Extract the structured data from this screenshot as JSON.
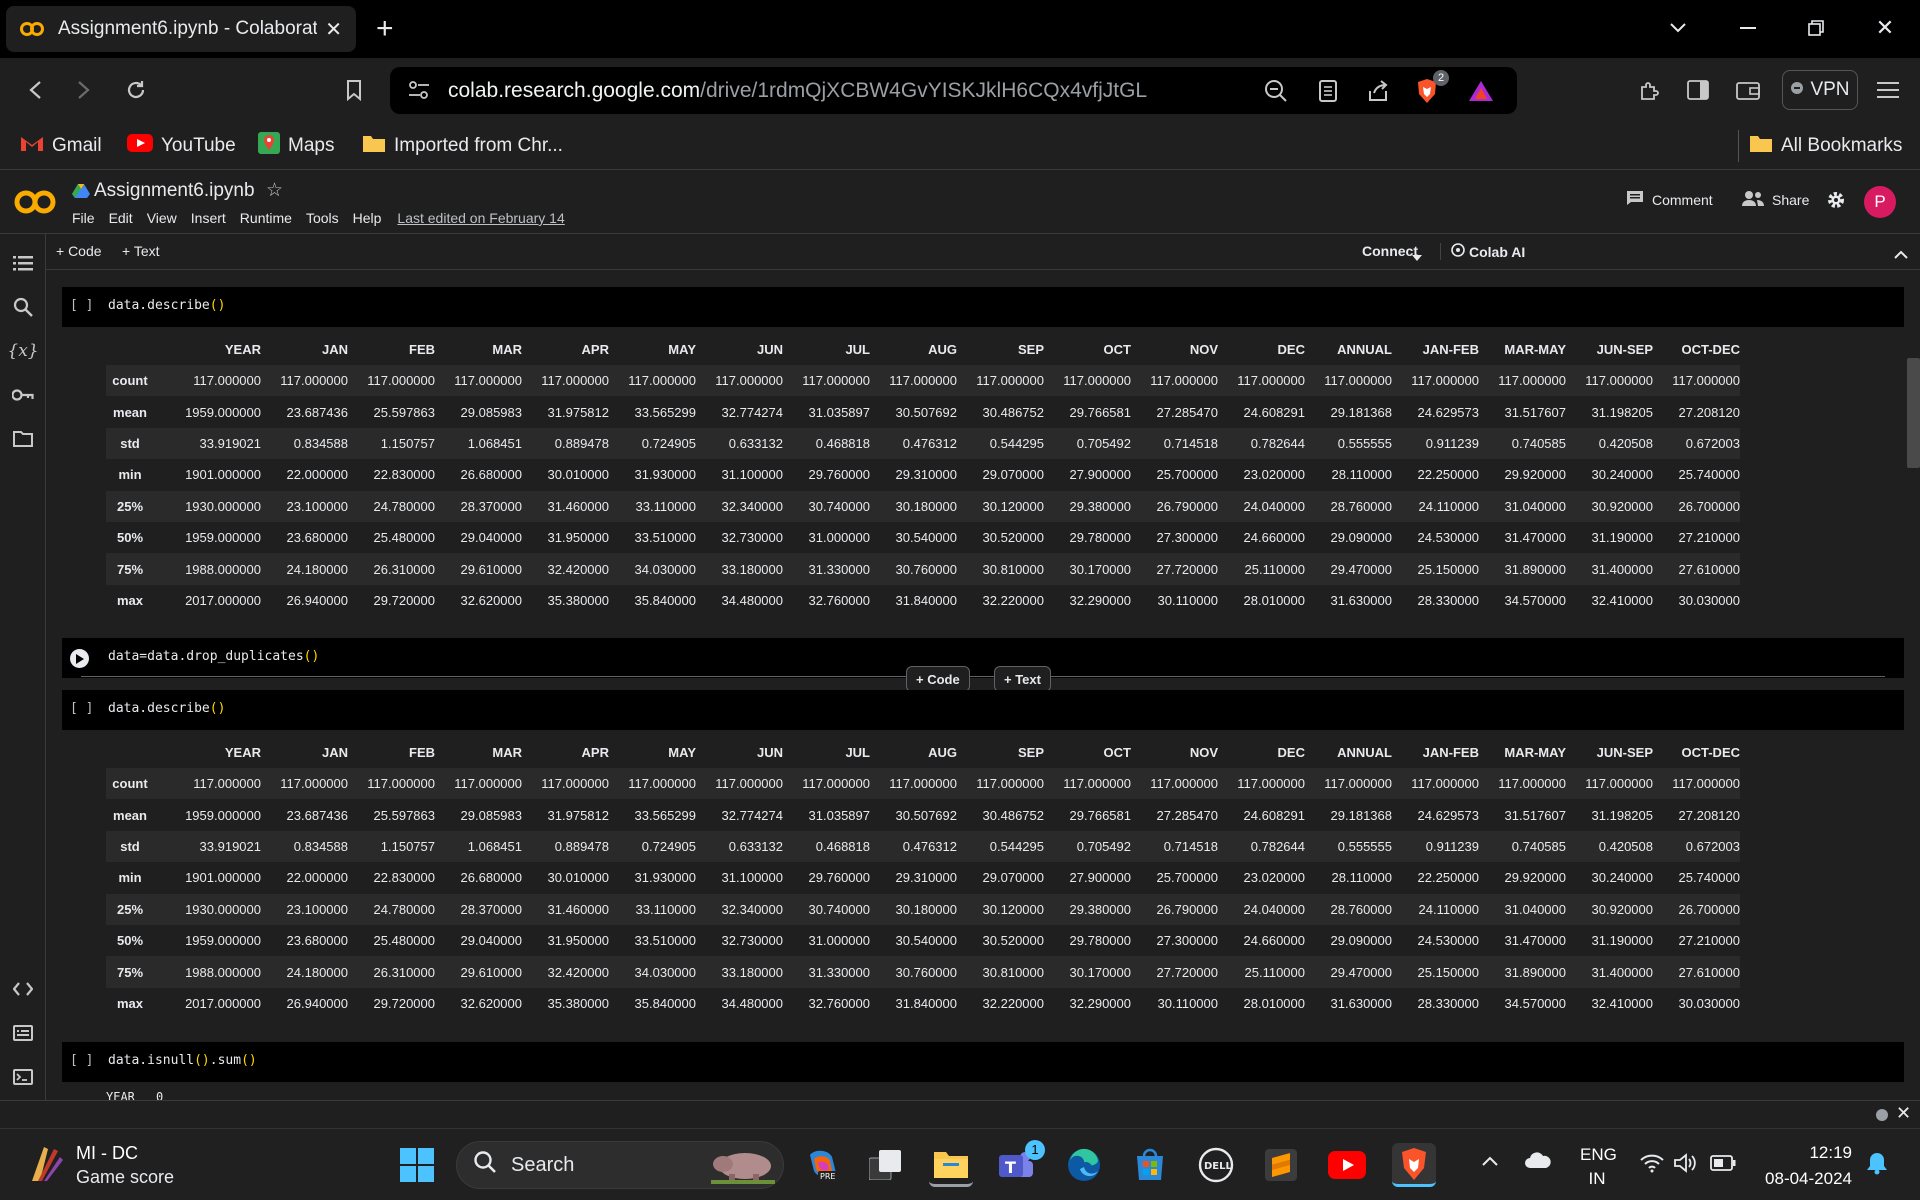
{
  "browser": {
    "tab_title": "Assignment6.ipynb - Colaboratory",
    "url_host": "colab.research.google.com",
    "url_path": "/drive/1rdmQjXCBW4GvYISKJklH6CQx4vfjJtGL",
    "brave_badge": "2",
    "vpn_label": "VPN",
    "bookmarks": [
      "Gmail",
      "YouTube",
      "Maps",
      "Imported from Chr..."
    ],
    "all_bookmarks": "All Bookmarks"
  },
  "colab": {
    "notebook_title": "Assignment6.ipynb",
    "menu": [
      "File",
      "Edit",
      "View",
      "Insert",
      "Runtime",
      "Tools",
      "Help"
    ],
    "last_edited": "Last edited on February 14",
    "comment_label": "Comment",
    "share_label": "Share",
    "avatar_letter": "P",
    "add_code": "+ Code",
    "add_text": "+ Text",
    "connect_label": "Connect",
    "colab_ai_label": "Colab AI"
  },
  "cells": {
    "cell1_bracket": "[ ]",
    "cell1_code": "data.describe",
    "cell2_code": "data=data.drop_duplicates",
    "cell3_bracket": "[ ]",
    "cell3_code": "data.describe",
    "cell4_bracket": "[ ]",
    "cell4_code": "data.isnull",
    "cell4_code_tail": ".sum",
    "cell4_output_label": "YEAR",
    "cell4_output_value": "0",
    "insert_code": "+ Code",
    "insert_text": "+ Text",
    "parens": "()"
  },
  "describe_table": {
    "columns": [
      "YEAR",
      "JAN",
      "FEB",
      "MAR",
      "APR",
      "MAY",
      "JUN",
      "JUL",
      "AUG",
      "SEP",
      "OCT",
      "NOV",
      "DEC",
      "ANNUAL",
      "JAN-FEB",
      "MAR-MAY",
      "JUN-SEP",
      "OCT-DEC"
    ],
    "rows": [
      {
        "label": "count",
        "values": [
          "117.000000",
          "117.000000",
          "117.000000",
          "117.000000",
          "117.000000",
          "117.000000",
          "117.000000",
          "117.000000",
          "117.000000",
          "117.000000",
          "117.000000",
          "117.000000",
          "117.000000",
          "117.000000",
          "117.000000",
          "117.000000",
          "117.000000",
          "117.000000"
        ]
      },
      {
        "label": "mean",
        "values": [
          "1959.000000",
          "23.687436",
          "25.597863",
          "29.085983",
          "31.975812",
          "33.565299",
          "32.774274",
          "31.035897",
          "30.507692",
          "30.486752",
          "29.766581",
          "27.285470",
          "24.608291",
          "29.181368",
          "24.629573",
          "31.517607",
          "31.198205",
          "27.208120"
        ]
      },
      {
        "label": "std",
        "values": [
          "33.919021",
          "0.834588",
          "1.150757",
          "1.068451",
          "0.889478",
          "0.724905",
          "0.633132",
          "0.468818",
          "0.476312",
          "0.544295",
          "0.705492",
          "0.714518",
          "0.782644",
          "0.555555",
          "0.911239",
          "0.740585",
          "0.420508",
          "0.672003"
        ]
      },
      {
        "label": "min",
        "values": [
          "1901.000000",
          "22.000000",
          "22.830000",
          "26.680000",
          "30.010000",
          "31.930000",
          "31.100000",
          "29.760000",
          "29.310000",
          "29.070000",
          "27.900000",
          "25.700000",
          "23.020000",
          "28.110000",
          "22.250000",
          "29.920000",
          "30.240000",
          "25.740000"
        ]
      },
      {
        "label": "25%",
        "values": [
          "1930.000000",
          "23.100000",
          "24.780000",
          "28.370000",
          "31.460000",
          "33.110000",
          "32.340000",
          "30.740000",
          "30.180000",
          "30.120000",
          "29.380000",
          "26.790000",
          "24.040000",
          "28.760000",
          "24.110000",
          "31.040000",
          "30.920000",
          "26.700000"
        ]
      },
      {
        "label": "50%",
        "values": [
          "1959.000000",
          "23.680000",
          "25.480000",
          "29.040000",
          "31.950000",
          "33.510000",
          "32.730000",
          "31.000000",
          "30.540000",
          "30.520000",
          "29.780000",
          "27.300000",
          "24.660000",
          "29.090000",
          "24.530000",
          "31.470000",
          "31.190000",
          "27.210000"
        ]
      },
      {
        "label": "75%",
        "values": [
          "1988.000000",
          "24.180000",
          "26.310000",
          "29.610000",
          "32.420000",
          "34.030000",
          "33.180000",
          "31.330000",
          "30.760000",
          "30.810000",
          "30.170000",
          "27.720000",
          "25.110000",
          "29.470000",
          "25.150000",
          "31.890000",
          "31.400000",
          "27.610000"
        ]
      },
      {
        "label": "max",
        "values": [
          "2017.000000",
          "26.940000",
          "29.720000",
          "32.620000",
          "35.380000",
          "35.840000",
          "34.480000",
          "32.760000",
          "31.840000",
          "32.220000",
          "32.290000",
          "30.110000",
          "28.010000",
          "31.630000",
          "28.330000",
          "34.570000",
          "32.410000",
          "30.030000"
        ]
      }
    ]
  },
  "taskbar": {
    "game_title": "MI - DC",
    "game_subtitle": "Game score",
    "search_label": "Search",
    "teams_badge": "1",
    "lang_top": "ENG",
    "lang_bottom": "IN",
    "time": "12:19",
    "date": "08-04-2024"
  }
}
